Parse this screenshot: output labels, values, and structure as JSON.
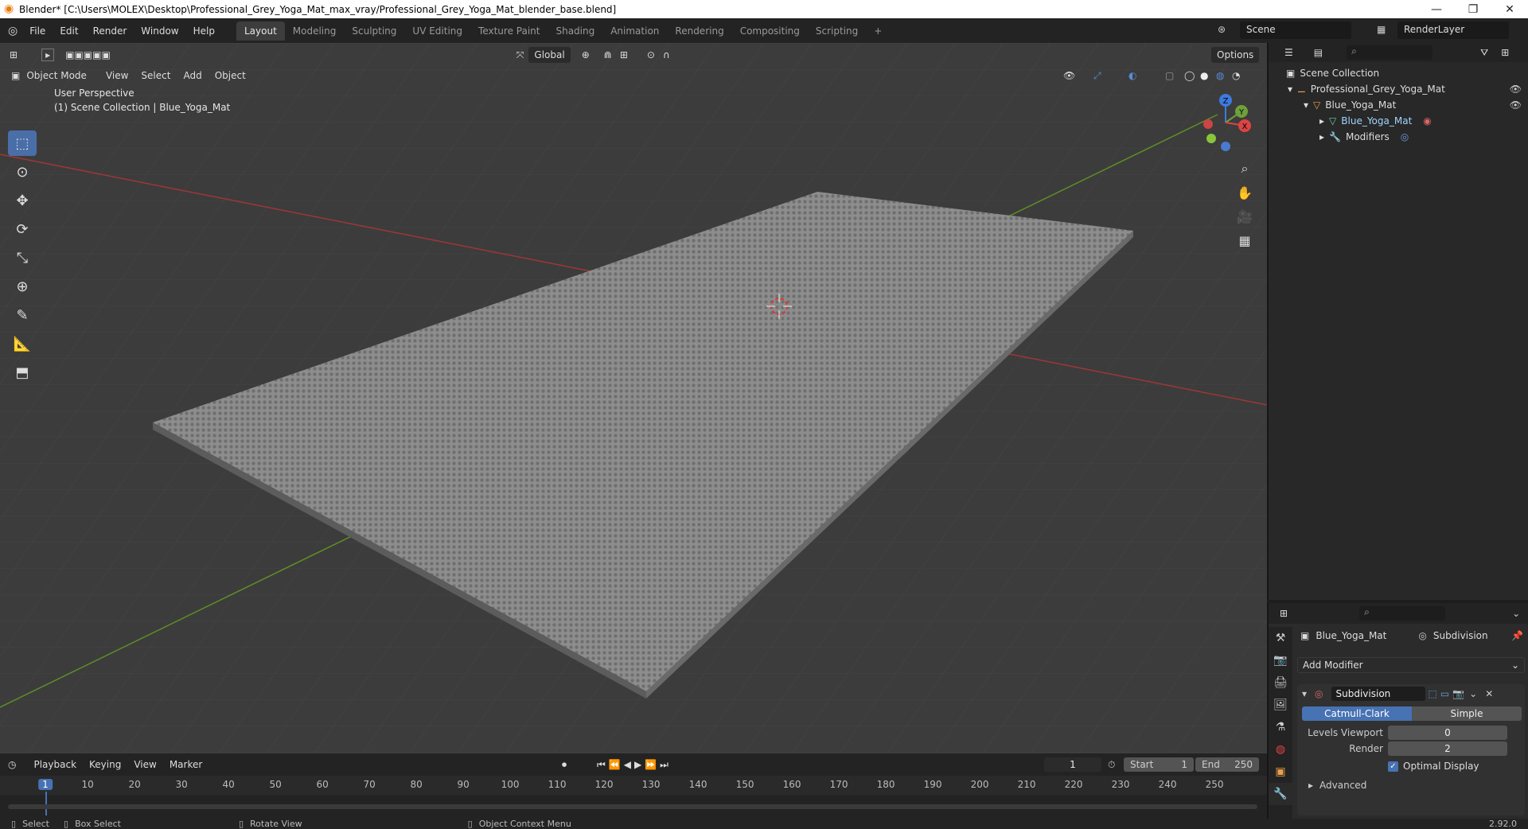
{
  "window": {
    "title": "Blender* [C:\\Users\\MOLEX\\Desktop\\Professional_Grey_Yoga_Mat_max_vray/Professional_Grey_Yoga_Mat_blender_base.blend]",
    "minimize": "—",
    "maximize": "❐",
    "close": "✕"
  },
  "menu": [
    "File",
    "Edit",
    "Render",
    "Window",
    "Help"
  ],
  "workspaces": [
    "Layout",
    "Modeling",
    "Sculpting",
    "UV Editing",
    "Texture Paint",
    "Shading",
    "Animation",
    "Rendering",
    "Compositing",
    "Scripting"
  ],
  "add_workspace": "+",
  "scene": {
    "label": "Scene",
    "renderlayer": "RenderLayer"
  },
  "viewport": {
    "mode": "Object Mode",
    "menus": [
      "View",
      "Select",
      "Add",
      "Object"
    ],
    "transform": "Global",
    "options": "Options",
    "overlay_line1": "User Perspective",
    "overlay_line2": "(1) Scene Collection | Blue_Yoga_Mat",
    "gizmo": {
      "z": "Z",
      "y": "Y",
      "x": "X"
    }
  },
  "outliner": {
    "root": "Scene Collection",
    "items": [
      {
        "label": "Professional_Grey_Yoga_Mat",
        "indent": 1
      },
      {
        "label": "Blue_Yoga_Mat",
        "indent": 2
      },
      {
        "label": "Blue_Yoga_Mat",
        "indent": 3
      },
      {
        "label": "Modifiers",
        "indent": 3
      }
    ]
  },
  "properties": {
    "object": "Blue_Yoga_Mat",
    "modifier_tab": "Subdivision",
    "add_modifier": "Add Modifier",
    "modifier_name": "Subdivision",
    "catmull": "Catmull-Clark",
    "simple": "Simple",
    "levels_viewport_label": "Levels Viewport",
    "levels_viewport": "0",
    "render_label": "Render",
    "render_value": "2",
    "optimal_display": "Optimal Display",
    "advanced": "Advanced"
  },
  "timeline": {
    "menus": [
      "Playback",
      "Keying",
      "View",
      "Marker"
    ],
    "current_frame": "1",
    "start_label": "Start",
    "start": "1",
    "end_label": "End",
    "end": "250",
    "ticks": [
      "1",
      "10",
      "20",
      "30",
      "40",
      "50",
      "60",
      "70",
      "80",
      "90",
      "100",
      "110",
      "120",
      "130",
      "140",
      "150",
      "160",
      "170",
      "180",
      "190",
      "200",
      "210",
      "220",
      "230",
      "240",
      "250"
    ]
  },
  "status": {
    "select": "Select",
    "box_select": "Box Select",
    "rotate": "Rotate View",
    "context": "Object Context Menu",
    "version": "2.92.0"
  },
  "colors": {
    "accent": "#4772b3",
    "grid_x": "#b03a3a",
    "grid_y": "#6a9a2a"
  }
}
